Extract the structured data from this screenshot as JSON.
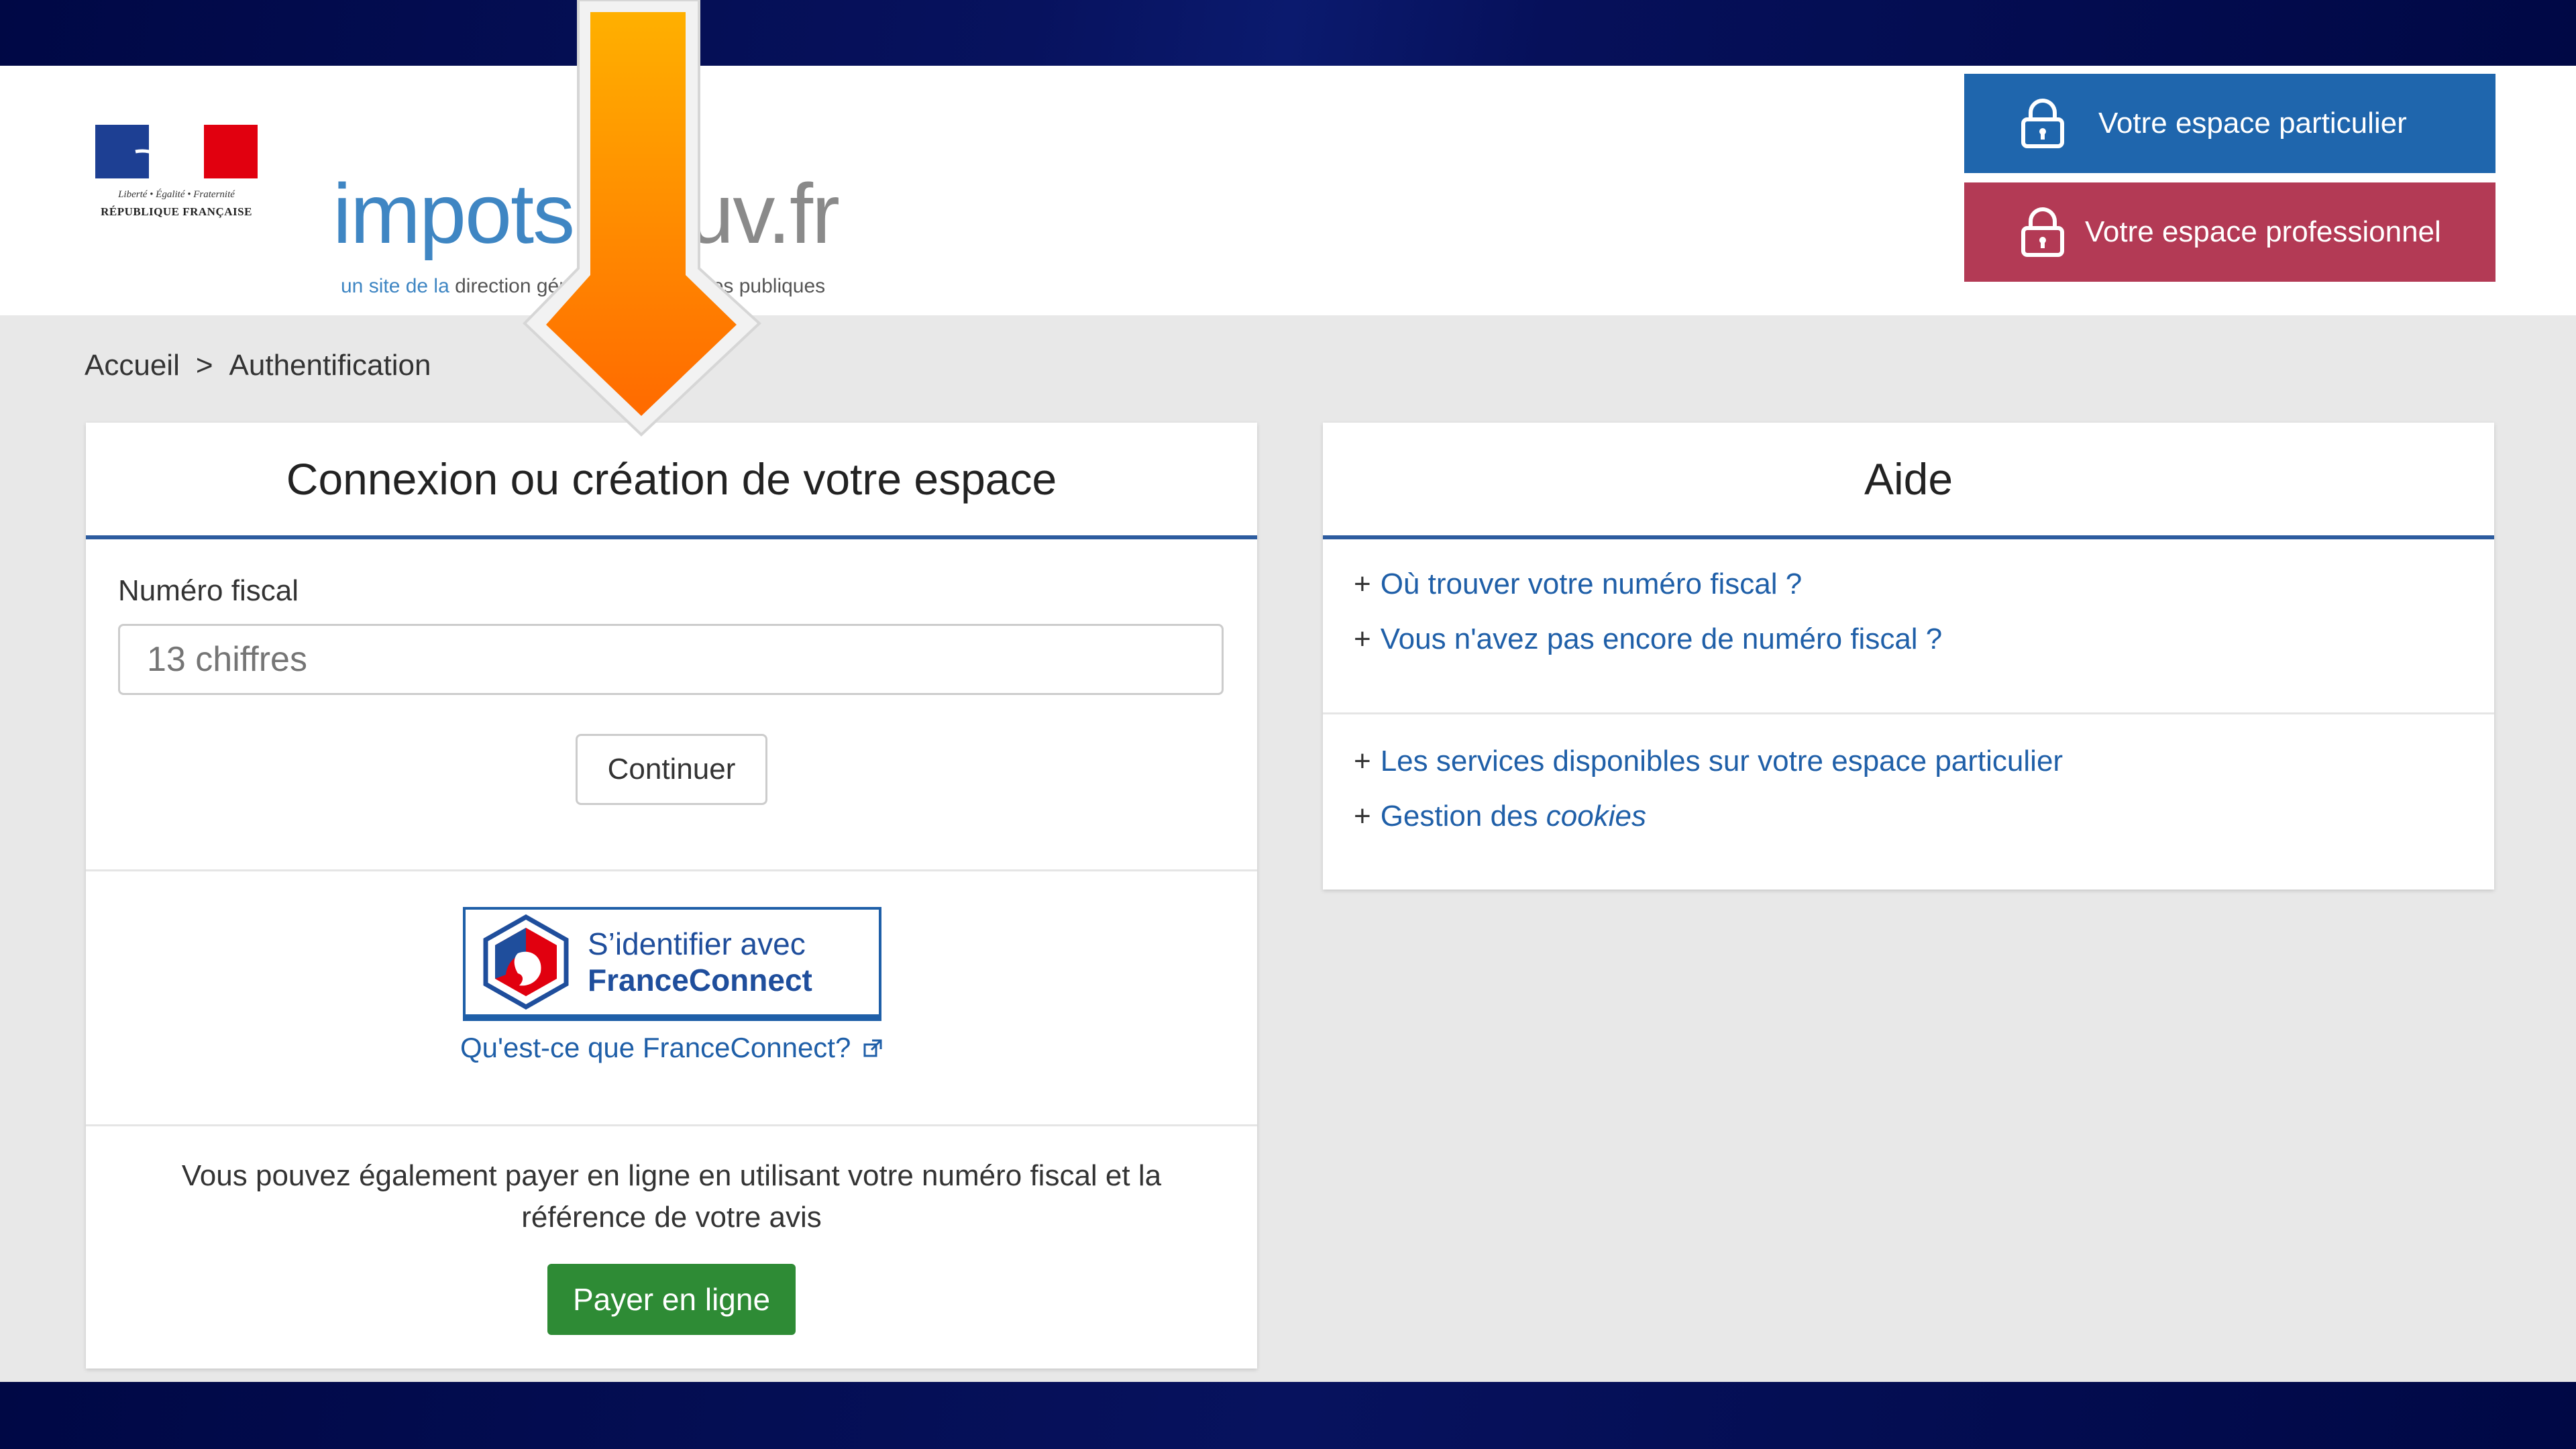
{
  "brand": {
    "name_part1": "impots",
    "name_part2": ".gouv.fr",
    "tagline_part1": "un site de la",
    "tagline_part2": "direction générale des finances publiques",
    "devise": "Liberté • Égalité • Fraternité",
    "republique": "RÉPUBLIQUE FRANÇAISE"
  },
  "header": {
    "btn_particulier": "Votre espace particulier",
    "btn_professionnel": "Votre espace professionnel"
  },
  "breadcrumb": {
    "home": "Accueil",
    "separator": ">",
    "current": "Authentification"
  },
  "login": {
    "title": "Connexion ou création de votre espace",
    "field_label": "Numéro fiscal",
    "field_placeholder": "13 chiffres",
    "continue_label": "Continuer",
    "fc_line1": "S’identifier avec",
    "fc_line2": "FranceConnect",
    "fc_link": "Qu'est-ce que FranceConnect?",
    "pay_text": "Vous pouvez également payer en ligne en utilisant votre numéro fiscal et la référence de votre avis",
    "pay_label": "Payer en ligne"
  },
  "help": {
    "title": "Aide",
    "plus": "+",
    "links": [
      "Où trouver votre numéro fiscal ?",
      "Vous n'avez pas encore de numéro fiscal ?",
      "Les services disponibles sur votre espace particulier"
    ],
    "cookies_prefix": "Gestion des",
    "cookies_word": "cookies"
  },
  "colors": {
    "frame": "#000845",
    "particulier": "#1f66ad",
    "professionnel": "#b33a55",
    "pay": "#2e8b35",
    "link": "#1f5fa8",
    "arrow": "#ff7f00"
  }
}
